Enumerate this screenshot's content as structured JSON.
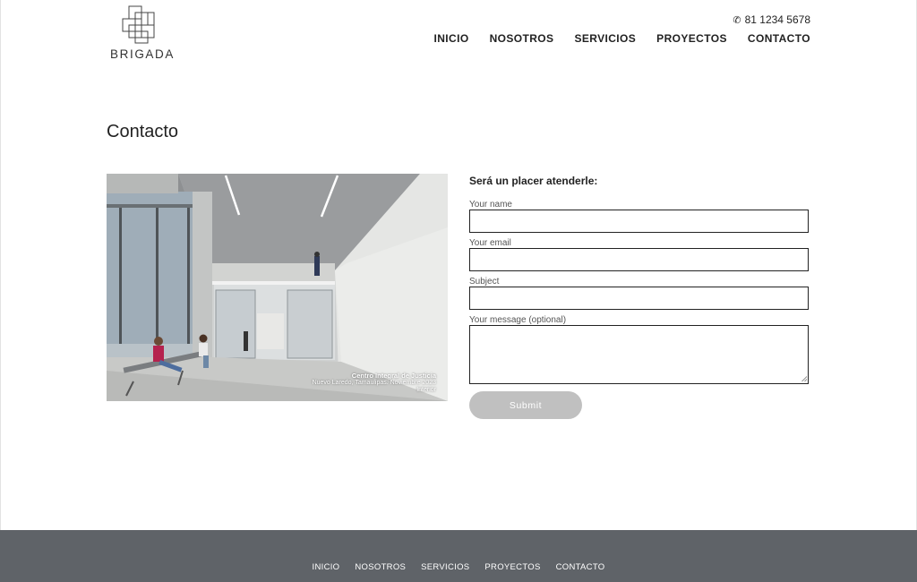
{
  "header": {
    "logo_text": "BRIGADA",
    "phone": "81 1234 5678",
    "nav": [
      "INICIO",
      "NOSOTROS",
      "SERVICIOS",
      "PROYECTOS",
      "CONTACTO"
    ]
  },
  "page": {
    "title": "Contacto"
  },
  "image": {
    "caption_line1": "Centro Integral de Justicia",
    "caption_line2": "Nuevo Laredo, Tamaulipas. Noviembre 2023",
    "caption_line3": "Interior"
  },
  "form": {
    "heading": "Será un placer atenderle:",
    "name_label": "Your name",
    "name_value": "",
    "email_label": "Your email",
    "email_value": "",
    "subject_label": "Subject",
    "subject_value": "",
    "message_label": "Your message (optional)",
    "message_value": "",
    "submit_label": "Submit"
  },
  "footer": {
    "nav": [
      "INICIO",
      "NOSOTROS",
      "SERVICIOS",
      "PROYECTOS",
      "CONTACTO"
    ]
  },
  "colors": {
    "footer_bg": "#5f6368",
    "submit_bg": "#c0c0c0",
    "text": "#222222"
  },
  "icons": {
    "phone": "phone-icon"
  }
}
